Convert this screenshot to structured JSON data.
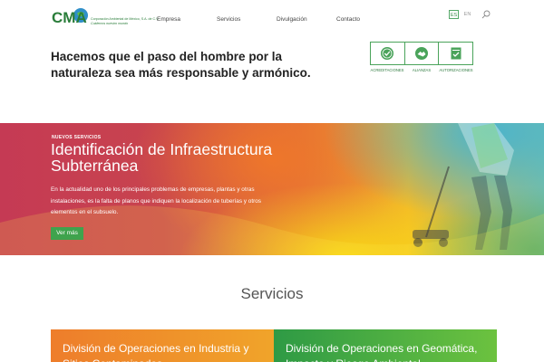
{
  "header": {
    "logo_text": "CMA",
    "logo_subtitle": "Corporación Ambiental de México, S.A. de C.V.",
    "logo_slogan": "Cuidemos nuestro mundo"
  },
  "nav": {
    "items": [
      {
        "label": "Empresa"
      },
      {
        "label": "Servicios"
      },
      {
        "label": "Divulgación"
      },
      {
        "label": "Contacto"
      }
    ]
  },
  "lang": {
    "es": "ES",
    "en": "EN",
    "active": "ES"
  },
  "tagline": "Hacemos que el paso del hombre por la naturaleza sea más responsable y armónico.",
  "badges": [
    {
      "label": "ACREDITACIONES",
      "icon": "seal-check-icon"
    },
    {
      "label": "ALIANZAS",
      "icon": "handshake-icon"
    },
    {
      "label": "AUTORIZACIONES",
      "icon": "document-check-icon"
    }
  ],
  "hero": {
    "overline": "NUEVOS SERVICIOS",
    "title": "Identificación de Infraestructura Subterránea",
    "body": "En la actualidad uno de los principales problemas de empresas, plantas y otras instalaciones, es la falta de planos que indiquen la localización de tuberías y otros elementos en el subsuelo.",
    "button": "Ver más"
  },
  "services": {
    "title": "Servicios",
    "cards": [
      {
        "title": "División de Operaciones en Industria y Sitios Contaminados"
      },
      {
        "title": "División de Operaciones en Geomática, Impacto y Riesgo Ambiental"
      }
    ]
  },
  "colors": {
    "brand_green": "#3fa34d",
    "card_orange": "#ee7d2b",
    "card_green": "#2e9a45"
  }
}
